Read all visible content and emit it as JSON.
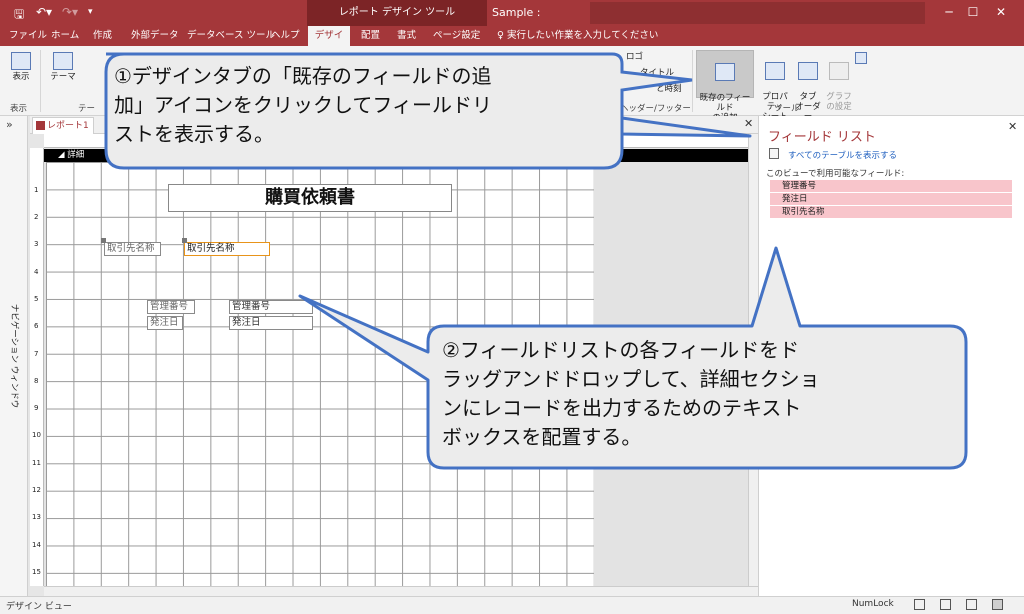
{
  "titlebar": {
    "context_tools": "レポート デザイン ツール",
    "doc_title": "Sample :",
    "quick_access": [
      "save-icon",
      "undo-icon",
      "redo-icon",
      "customize-icon"
    ],
    "window_buttons": [
      "─",
      "☐",
      "✕"
    ]
  },
  "tabs": [
    "ファイル",
    "ホーム",
    "作成",
    "外部データ",
    "データベース ツール",
    "ヘルプ",
    "デザイン",
    "配置",
    "書式",
    "ページ設定"
  ],
  "active_tab": "デザイン",
  "tell_me": "実行したい作業を入力してください",
  "ribbon": {
    "view_label": "表示",
    "view_group": "表示",
    "theme_label": "テーマ",
    "theme_group_partial": "テー",
    "logo_label": "ロゴ",
    "title_label": "タイトル",
    "datetime_label": "と時刻",
    "header_footer_group": "ヘッダー/フッター",
    "add_fields_label": "既存のフィールド\nの追加",
    "property_sheet_label": "プロパティ\nシート",
    "tab_order_label": "タブ\nオーダー",
    "chart_settings_label": "グラフ\nの設定",
    "tools_group": "ツール"
  },
  "document": {
    "tab_label": "レポート1",
    "section_label": "詳細",
    "report_title": "購買依頼書",
    "controls": [
      {
        "label": "取引先名称",
        "field": "取引先名称"
      },
      {
        "label": "管理番号",
        "field": "管理番号"
      },
      {
        "label": "発注日",
        "field": "発注日"
      }
    ],
    "ruler_numbers": [
      "1",
      "2",
      "3",
      "4",
      "5",
      "6",
      "7",
      "8",
      "9",
      "10",
      "11",
      "12",
      "13",
      "14",
      "15"
    ]
  },
  "navpane": {
    "label": "ナビゲーション ウィンドウ",
    "toggle": "»"
  },
  "field_list": {
    "title": "フィールド リスト",
    "show_all": "すべてのテーブルを表示する",
    "available_label": "このビューで利用可能なフィールド:",
    "fields": [
      "管理番号",
      "発注日",
      "取引先名称"
    ]
  },
  "status": {
    "left": "デザイン ビュー",
    "numlock": "NumLock"
  },
  "callouts": [
    {
      "lines": [
        "①デザインタブの「既存のフィールドの追",
        "加」アイコンをクリックしてフィールドリ",
        "ストを表示する。"
      ]
    },
    {
      "lines": [
        "②フィールドリストの各フィールドをド",
        "ラッグアンドドロップして、詳細セクショ",
        "ンにレコードを出力するためのテキスト",
        "ボックスを配置する。"
      ]
    }
  ]
}
